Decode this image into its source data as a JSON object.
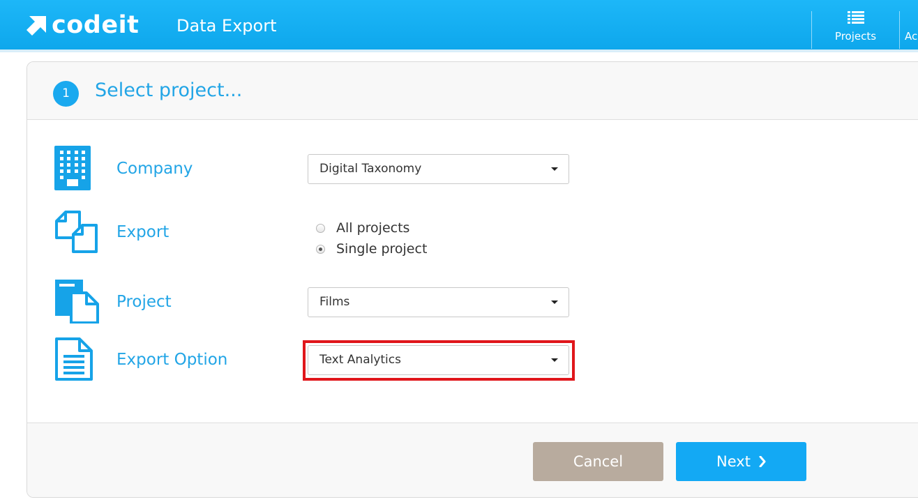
{
  "header": {
    "logo_text": "codeit",
    "page_title": "Data Export",
    "nav": [
      {
        "label": "Projects",
        "icon": "list-icon"
      },
      {
        "label": "Ac",
        "icon": ""
      }
    ],
    "bg_color": "#12acf2"
  },
  "step": {
    "number": "1",
    "title": "Select project..."
  },
  "rows": {
    "company": {
      "label": "Company",
      "icon": "building-icon",
      "value": "Digital Taxonomy"
    },
    "export": {
      "label": "Export",
      "icon": "copy-documents-icon",
      "options": [
        {
          "label": "All projects",
          "checked": false
        },
        {
          "label": "Single project",
          "checked": true
        }
      ]
    },
    "project": {
      "label": "Project",
      "icon": "documents-icon",
      "value": "Films"
    },
    "export_option": {
      "label": "Export Option",
      "icon": "file-text-icon",
      "value": "Text Analytics"
    }
  },
  "footer": {
    "cancel_label": "Cancel",
    "next_label": "Next"
  },
  "colors": {
    "accent": "#22a5e6",
    "cancel": "#b8ab9e",
    "next": "#13a9f4",
    "highlight": "#e0161b"
  }
}
